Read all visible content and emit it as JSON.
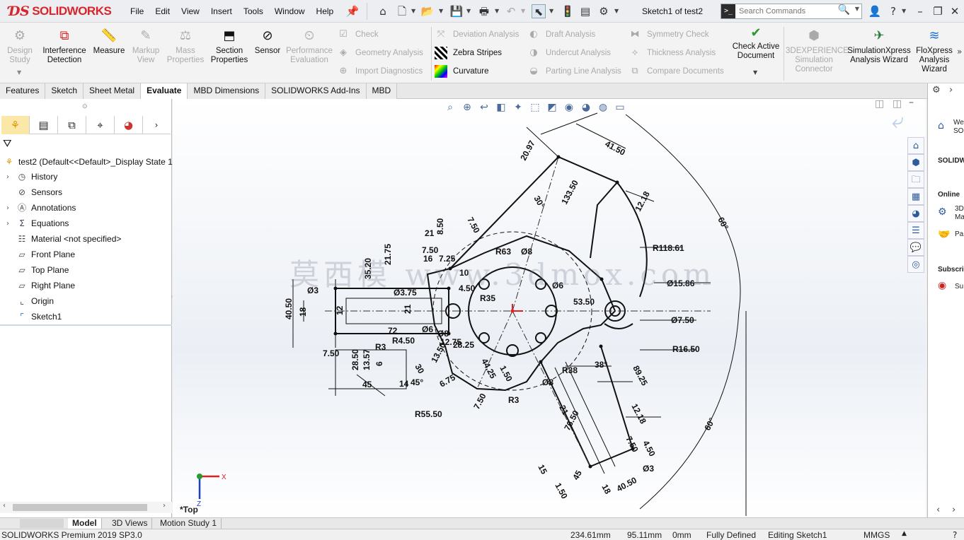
{
  "app": {
    "brand": "SOLIDWORKS",
    "menus": [
      "File",
      "Edit",
      "View",
      "Insert",
      "Tools",
      "Window",
      "Help"
    ],
    "document_title": "Sketch1 of test2",
    "search_placeholder": "Search Commands"
  },
  "command_manager": {
    "big_tools": [
      {
        "label": "Design\nStudy",
        "icon": "design-study-icon",
        "enabled": false
      },
      {
        "label": "Interference\nDetection",
        "icon": "interference-icon",
        "enabled": true
      },
      {
        "label": "Measure",
        "icon": "measure-icon",
        "enabled": true
      },
      {
        "label": "Markup\nView",
        "icon": "markup-icon",
        "enabled": false
      },
      {
        "label": "Mass\nProperties",
        "icon": "mass-properties-icon",
        "enabled": false
      },
      {
        "label": "Section\nProperties",
        "icon": "section-properties-icon",
        "enabled": true
      },
      {
        "label": "Sensor",
        "icon": "sensor-icon",
        "enabled": true
      },
      {
        "label": "Performance\nEvaluation",
        "icon": "performance-icon",
        "enabled": false
      }
    ],
    "small_tools_col1": [
      {
        "label": "Check",
        "enabled": false
      },
      {
        "label": "Geometry Analysis",
        "enabled": false
      },
      {
        "label": "Import Diagnostics",
        "enabled": false
      }
    ],
    "small_tools_col2": [
      {
        "label": "Deviation Analysis",
        "enabled": false
      },
      {
        "label": "Zebra Stripes",
        "enabled": true
      },
      {
        "label": "Curvature",
        "enabled": true
      }
    ],
    "small_tools_col3": [
      {
        "label": "Draft Analysis",
        "enabled": false
      },
      {
        "label": "Undercut Analysis",
        "enabled": false
      },
      {
        "label": "Parting Line Analysis",
        "enabled": false
      }
    ],
    "small_tools_col4": [
      {
        "label": "Symmetry Check",
        "enabled": false
      },
      {
        "label": "Thickness Analysis",
        "enabled": false
      },
      {
        "label": "Compare Documents",
        "enabled": false
      }
    ],
    "right_tools": [
      {
        "label": "Check Active\nDocument",
        "enabled": true
      },
      {
        "label": "3DEXPERIENCE\nSimulation\nConnector",
        "enabled": false
      },
      {
        "label": "SimulationXpress\nAnalysis Wizard",
        "enabled": true
      },
      {
        "label": "FloXpress\nAnalysis\nWizard",
        "enabled": true
      }
    ]
  },
  "tabs": [
    "Features",
    "Sketch",
    "Sheet Metal",
    "Evaluate",
    "MBD Dimensions",
    "SOLIDWORKS Add-Ins",
    "MBD"
  ],
  "active_tab": "Evaluate",
  "feature_tree": {
    "root": "test2  (Default<<Default>_Display State 1>)",
    "items": [
      {
        "label": "History",
        "expandable": true,
        "icon": "history-icon"
      },
      {
        "label": "Sensors",
        "expandable": false,
        "icon": "sensors-icon"
      },
      {
        "label": "Annotations",
        "expandable": true,
        "icon": "annotations-icon"
      },
      {
        "label": "Equations",
        "expandable": true,
        "icon": "equations-icon"
      },
      {
        "label": "Material <not specified>",
        "expandable": false,
        "icon": "material-icon"
      },
      {
        "label": "Front Plane",
        "expandable": false,
        "icon": "plane-icon"
      },
      {
        "label": "Top Plane",
        "expandable": false,
        "icon": "plane-icon"
      },
      {
        "label": "Right Plane",
        "expandable": false,
        "icon": "plane-icon"
      },
      {
        "label": "Origin",
        "expandable": false,
        "icon": "origin-icon"
      },
      {
        "label": "Sketch1",
        "expandable": false,
        "icon": "sketch-icon"
      }
    ]
  },
  "viewport": {
    "view_name": "*Top",
    "watermark": "莫西模 www.3dmox.com",
    "dimensions": [
      "20.97",
      "41.50",
      "133.50",
      "30°",
      "12.18",
      "60°",
      "7.50",
      "8.50",
      "21",
      "R118.61",
      "R63",
      "Ø8",
      "21.75",
      "35.20",
      "16",
      "7.50",
      "7.25",
      "Ø3",
      "10",
      "Ø15.86",
      "40.50",
      "18",
      "12",
      "Ø3.75",
      "21",
      "4.50",
      "R35",
      "Ø6",
      "53.50",
      "Ø7.50",
      "72",
      "Ø6",
      "Ø8",
      "R4.50",
      "12.75",
      "28.25",
      "R16.50",
      "7.50",
      "R3",
      "28.50",
      "13.57",
      "6",
      "30",
      "13.50",
      "44.25",
      "1.50",
      "R38",
      "38°",
      "89.25",
      "45",
      "14",
      "45°",
      "6.75",
      "Ø8",
      "7.50",
      "R3",
      "21",
      "R55.50",
      "12.18",
      "4.50",
      "76.50",
      "7.50",
      "Ø3",
      "15",
      "1.50",
      "18",
      "40.50",
      "60°",
      "45"
    ],
    "triad": {
      "x": "X",
      "z": "Z"
    }
  },
  "task_pane": {
    "labels": [
      "We\nSO",
      "SOLIDW",
      "Online",
      "3D\nMa",
      "Pa",
      "Subscri",
      "Su"
    ]
  },
  "bottom_tabs": [
    "Model",
    "3D Views",
    "Motion Study 1"
  ],
  "active_bottom_tab": "Model",
  "status": {
    "product": "SOLIDWORKS Premium 2019 SP3.0",
    "x": "234.61mm",
    "y": "95.11mm",
    "z": "0mm",
    "state": "Fully Defined",
    "mode": "Editing Sketch1",
    "units": "MMGS"
  }
}
